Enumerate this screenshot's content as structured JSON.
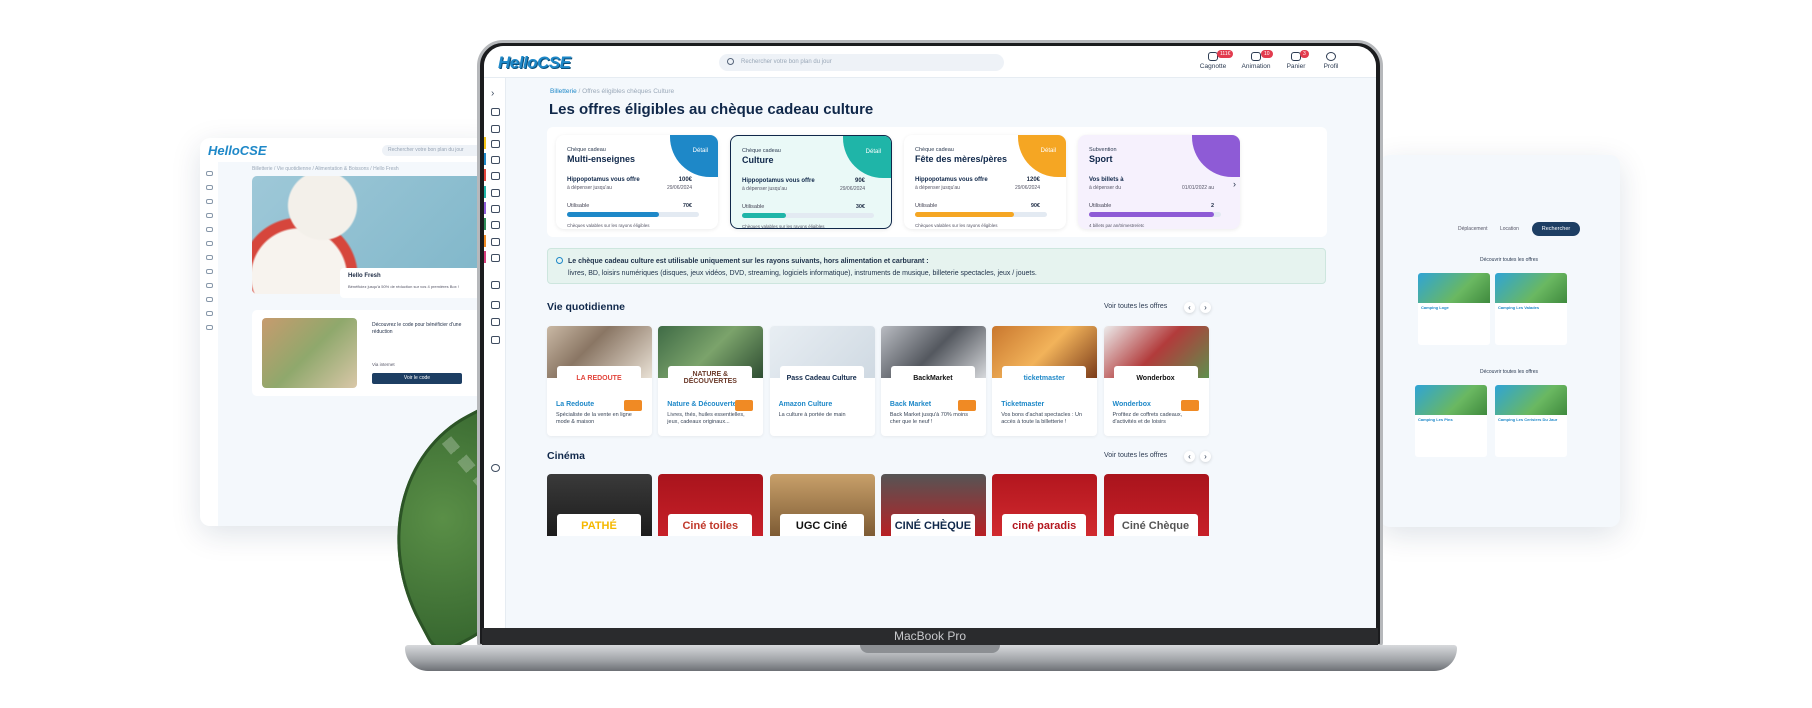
{
  "app": {
    "logo": "HelloCSE"
  },
  "header": {
    "search_placeholder": "Rechercher votre bon plan du jour",
    "nav": [
      {
        "label": "Cagnotte",
        "badge": "111€"
      },
      {
        "label": "Animation",
        "badge": "10"
      },
      {
        "label": "Panier",
        "badge": "3"
      },
      {
        "label": "Profil",
        "badge": ""
      }
    ]
  },
  "breadcrumb": {
    "root": "Billetterie",
    "current": "Offres éligibles chèques Culture"
  },
  "page_title": "Les offres éligibles au chèque cadeau culture",
  "cards": [
    {
      "kicker": "Chèque cadeau",
      "title": "Multi-enseignes",
      "detail": "Détail",
      "offer_label": "Hippopotamus vous offre",
      "offer_value": "100€",
      "spend_label": "à dépenser jusqu'au",
      "spend_date": "29/06/2024",
      "usable_label": "Utilisable",
      "usable_value": "70€",
      "usable_fraction": 0.7,
      "note": "Chèques valables sur les rayons éligibles",
      "color": "#1e88c8"
    },
    {
      "kicker": "Chèque cadeau",
      "title": "Culture",
      "detail": "Détail",
      "offer_label": "Hippopotamus vous offre",
      "offer_value": "90€",
      "spend_label": "à dépenser jusqu'au",
      "spend_date": "29/06/2024",
      "usable_label": "Utilisable",
      "usable_value": "30€",
      "usable_fraction": 0.33,
      "note": "Chèques valables sur les rayons éligibles",
      "color": "#1fb5a8"
    },
    {
      "kicker": "Chèque cadeau",
      "title": "Fête des mères/pères",
      "detail": "Détail",
      "offer_label": "Hippopotamus vous offre",
      "offer_value": "120€",
      "spend_label": "à dépenser jusqu'au",
      "spend_date": "29/06/2024",
      "usable_label": "Utilisable",
      "usable_value": "90€",
      "usable_fraction": 0.75,
      "note": "Chèques valables sur les rayons éligibles",
      "color": "#f5a623"
    },
    {
      "kicker": "Subvention",
      "title": "Sport",
      "detail": "",
      "offer_label": "Vos billets à",
      "offer_value": "",
      "spend_label": "à dépenser du",
      "spend_date": "01/01/2022 au",
      "usable_label": "Utilisable",
      "usable_value": "2",
      "usable_fraction": 0.95,
      "note": "4 billets par an/trimestre/etc",
      "color": "#8e5bd6"
    }
  ],
  "info": {
    "title": "Le chèque cadeau culture est utilisable uniquement sur les rayons suivants, hors alimentation et carburant :",
    "body": "livres, BD, loisirs numériques (disques, jeux vidéos, DVD, streaming, logiciels informatique), instruments de musique, billeterie spectacles, jeux / jouets."
  },
  "sections": {
    "daily": {
      "title": "Vie quotidienne",
      "see_all": "Voir toutes les offres"
    },
    "cinema": {
      "title": "Cinéma",
      "see_all": "Voir toutes les offres"
    }
  },
  "offers": [
    {
      "name": "La Redoute",
      "logo": "LA REDOUTE",
      "desc": "Spécialiste de la vente en ligne mode & maison"
    },
    {
      "name": "Nature & Découverte",
      "logo": "NATURE & DÉCOUVERTES",
      "desc": "Livres, thés, huiles essentielles, jeux, cadeaux originaux..."
    },
    {
      "name": "Amazon Culture",
      "logo": "Pass Cadeau Culture",
      "desc": "La culture à portée de main"
    },
    {
      "name": "Back Market",
      "logo": "BackMarket",
      "desc": "Back Market jusqu'à 70% moins cher que le neuf !"
    },
    {
      "name": "Ticketmaster",
      "logo": "ticketmaster",
      "desc": "Vos bons d'achat spectacles : Un accès à toute la billetterie !"
    },
    {
      "name": "Wonderbox",
      "logo": "Wonderbox",
      "desc": "Profitez de coffrets cadeaux, d'activités et de loisirs"
    }
  ],
  "cinemas": [
    {
      "logo": "PATHÉ"
    },
    {
      "logo": "Ciné toiles"
    },
    {
      "logo": "UGC Ciné"
    },
    {
      "logo": "CINÉ CHÈQUE"
    },
    {
      "logo": "ciné paradis"
    },
    {
      "logo": "Ciné Chèque"
    }
  ],
  "laptop": {
    "label": "MacBook Pro"
  },
  "bg_left": {
    "logo": "HelloCSE",
    "search": "Rechercher votre bon plan du jour",
    "crumb": "Billetterie / Vie quotidienne / Alimentation & Boissons / Hello Fresh",
    "offer_name": "Hello Fresh",
    "offer_desc": "Bénéficiez jusqu'à 50% de réduction sur vos 4 premières Box !",
    "code_text": "Découvrez le code pour bénéficier d'une réduction",
    "via": "Via internet",
    "code_button": "Voir le code"
  },
  "bg_right": {
    "search_button": "Rechercher",
    "location": "Location",
    "moving": "Déplacement",
    "see_all_1": "Découvrir toutes les offres",
    "see_all_2": "Découvrir toutes les offres",
    "camp1": "Camping Les Valades",
    "camp2": "Camping Les Pins",
    "camp3": "Camping Les Cerisiers Du Jaur",
    "camp4": "Camping Loge"
  }
}
